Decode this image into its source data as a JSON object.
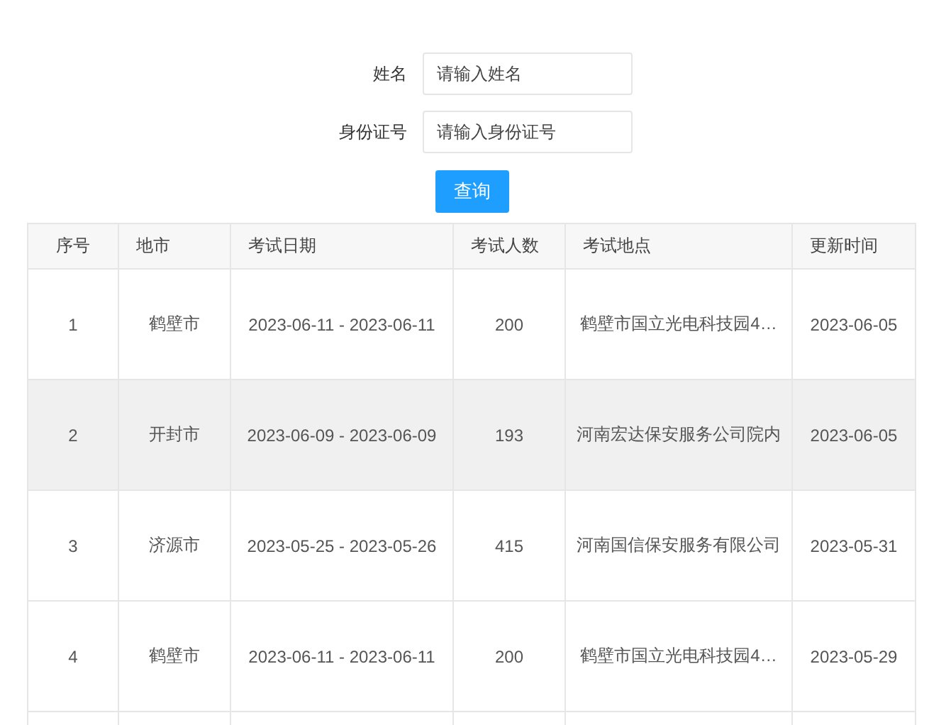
{
  "form": {
    "fields": [
      {
        "label": "姓名",
        "placeholder": "请输入姓名"
      },
      {
        "label": "身份证号",
        "placeholder": "请输入身份证号"
      }
    ],
    "button": "查询"
  },
  "table": {
    "columns": [
      "序号",
      "地市",
      "考试日期",
      "考试人数",
      "考试地点",
      "更新时间"
    ],
    "rows": [
      {
        "selected": false,
        "cells": [
          "1",
          "鹤壁市",
          "2023-06-11 - 2023-06-11",
          "200",
          "鹤壁市国立光电科技园4…",
          "2023-06-05"
        ]
      },
      {
        "selected": true,
        "cells": [
          "2",
          "开封市",
          "2023-06-09 - 2023-06-09",
          "193",
          "河南宏达保安服务公司院内",
          "2023-06-05"
        ]
      },
      {
        "selected": false,
        "cells": [
          "3",
          "济源市",
          "2023-05-25 - 2023-05-26",
          "415",
          "河南国信保安服务有限公司",
          "2023-05-31"
        ]
      },
      {
        "selected": false,
        "cells": [
          "4",
          "鹤壁市",
          "2023-06-11 - 2023-06-11",
          "200",
          "鹤壁市国立光电科技园4…",
          "2023-05-29"
        ]
      }
    ]
  }
}
